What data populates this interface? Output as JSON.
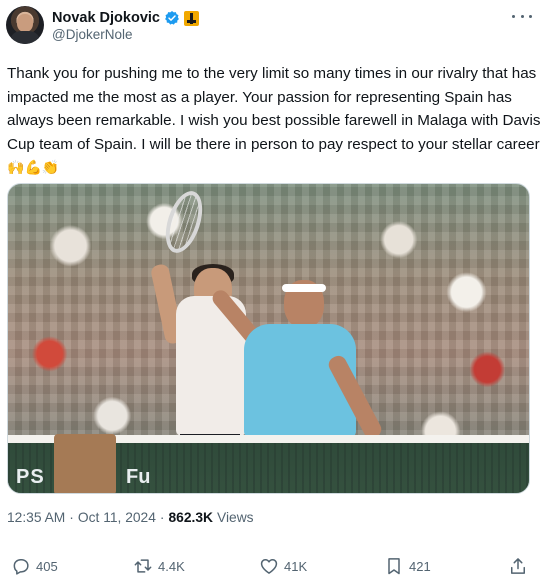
{
  "author": {
    "display_name": "Novak Djokovic",
    "handle": "@DjokerNole",
    "verified": true,
    "affiliate_badge": "flag-badge-icon"
  },
  "tweet": {
    "text": "Thank you for pushing me to the very limit so many times in our rivalry that has impacted me the most as a player. Your passion for representing Spain has always been remarkable. I wish you best possible farewell in Malaga with Davis Cup team of Spain. I will be there in person to pay respect to your stellar career",
    "emojis": [
      "🙌",
      "💪",
      "👏"
    ]
  },
  "media": {
    "wall_text_left": "PS",
    "wall_text_right": "Fu"
  },
  "meta": {
    "time": "12:35 AM",
    "separator": "·",
    "date": "Oct 11, 2024",
    "views_count": "862.3K",
    "views_label": "Views"
  },
  "actions": {
    "replies": "405",
    "reposts": "4.4K",
    "likes": "41K",
    "bookmarks": "421"
  },
  "colors": {
    "text_primary": "#0f1419",
    "text_secondary": "#536471",
    "verified_blue": "#1d9bf0",
    "badge_gold": "#f1a800"
  }
}
